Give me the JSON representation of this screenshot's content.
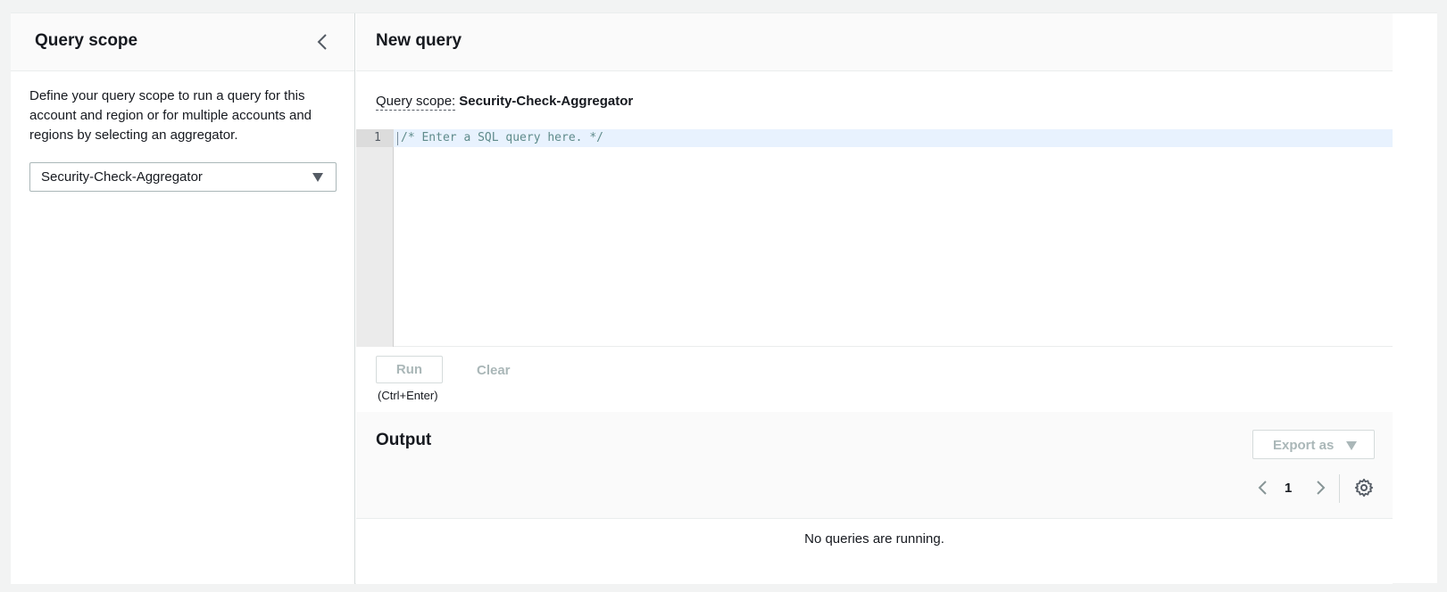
{
  "scope_panel": {
    "title": "Query scope",
    "description": "Define your query scope to run a query for this account and region or for multiple accounts and regions by selecting an aggregator.",
    "aggregator_selected": "Security-Check-Aggregator"
  },
  "query": {
    "title": "New query",
    "scope_label": "Query scope:",
    "scope_value": "Security-Check-Aggregator",
    "editor": {
      "line_number": "1",
      "code": "/* Enter a SQL query here. */"
    },
    "run_label": "Run",
    "run_hint": "(Ctrl+Enter)",
    "clear_label": "Clear"
  },
  "output": {
    "title": "Output",
    "export_label": "Export as",
    "page_number": "1",
    "empty_message": "No queries are running."
  },
  "icons": {
    "collapse": "chevron-left-icon",
    "prev": "chevron-left-icon",
    "next": "chevron-right-icon",
    "settings": "gear-icon",
    "dropdown": "caret-down-icon"
  },
  "colors": {
    "disabled_text": "#aab7b8",
    "active_line": "#e8f2fe",
    "comment": "#5f8b8b"
  }
}
